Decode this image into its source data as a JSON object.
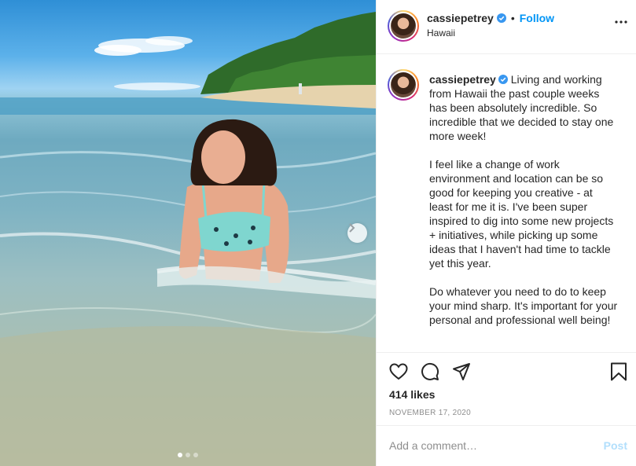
{
  "post": {
    "image_alt": "Woman in a teal dinosaur-print bikini top sitting in shallow ocean water at a beach",
    "carousel": {
      "count": 3,
      "active_index": 0
    }
  },
  "header": {
    "username": "cassiepetrey",
    "separator": "•",
    "follow_label": "Follow",
    "location": "Hawaii"
  },
  "caption": {
    "username": "cassiepetrey",
    "text": " Living and working from Hawaii the past couple weeks has been absolutely incredible. So incredible that we decided to stay one more week!\n\nI feel like a change of work environment and location can be so good for keeping you creative - at least for me it is. I've been super inspired to dig into some new projects + initiatives, while picking up some ideas that I haven't had time to tackle yet this year.\n\nDo whatever you need to do to keep your mind sharp. It's important for your personal and professional well being!"
  },
  "engagement": {
    "likes": "414 likes",
    "date": "NOVEMBER 17, 2020"
  },
  "comment": {
    "placeholder": "Add a comment…",
    "post_label": "Post"
  },
  "colors": {
    "accent": "#0095f6",
    "post_disabled": "#b2dffc",
    "muted": "#8e8e8e"
  },
  "icons": [
    "verified-badge-icon",
    "more-options-icon",
    "heart-icon",
    "comment-icon",
    "share-icon",
    "bookmark-icon",
    "chevron-right-icon"
  ]
}
